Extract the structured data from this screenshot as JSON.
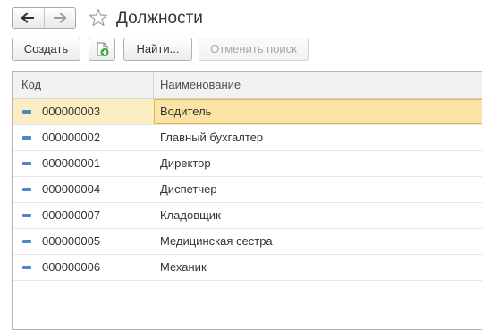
{
  "window": {
    "title": "Должности"
  },
  "nav": {
    "back_icon": "arrow-left-icon",
    "forward_icon": "arrow-right-icon",
    "favorite_icon": "star-icon"
  },
  "toolbar": {
    "create_label": "Создать",
    "add_icon": "add-document-icon",
    "find_label": "Найти...",
    "cancel_search_label": "Отменить поиск"
  },
  "table": {
    "columns": [
      "Код",
      "Наименование"
    ],
    "rows": [
      {
        "code": "000000003",
        "name": "Водитель",
        "selected": true
      },
      {
        "code": "000000002",
        "name": "Главный бухгалтер"
      },
      {
        "code": "000000001",
        "name": "Директор"
      },
      {
        "code": "000000004",
        "name": "Диспетчер"
      },
      {
        "code": "000000007",
        "name": "Кладовщик"
      },
      {
        "code": "000000005",
        "name": "Медицинская сестра"
      },
      {
        "code": "000000006",
        "name": "Механик"
      }
    ]
  },
  "colors": {
    "accent": "#4a86c8",
    "selected_row": "#fbeec2",
    "selected_cell": "#fbe3a5",
    "add_icon_green": "#3aa53a"
  }
}
